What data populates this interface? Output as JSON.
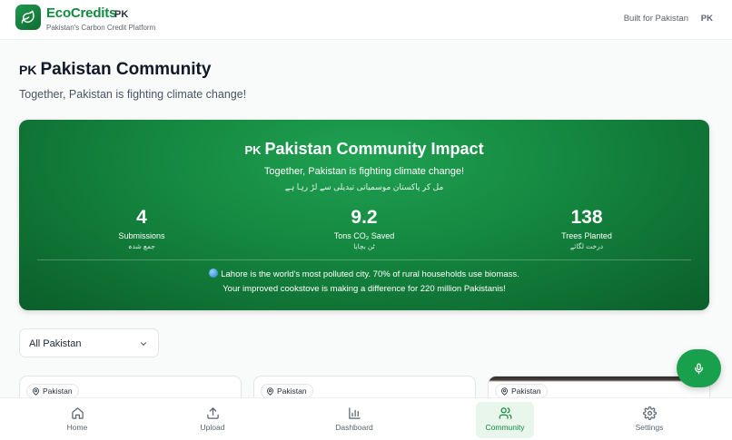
{
  "header": {
    "app_name": "EcoCredits",
    "flag": "PK",
    "tagline": "Pakistan's Carbon Credit Platform",
    "built_for": "Built for Pakistan",
    "built_flag": "PK"
  },
  "page": {
    "flag": "PK",
    "title": "Pakistan Community",
    "subtitle": "Together, Pakistan is fighting climate change!"
  },
  "impact": {
    "flag": "PK",
    "title": "Pakistan Community Impact",
    "subtitle": "Together, Pakistan is fighting climate change!",
    "subtitle_urdu": "مل کر پاکستان موسمیاتی تبدیلی سے لڑ رہا ہے",
    "stats": [
      {
        "value": "4",
        "label": "Submissions",
        "label_urdu": "جمع شدہ"
      },
      {
        "value": "9.2",
        "label": "Tons CO₂ Saved",
        "label_urdu": "ٹن بچایا"
      },
      {
        "value": "138",
        "label": "Trees Planted",
        "label_urdu": "درخت لگائے"
      }
    ],
    "fact_line1": "Lahore is the world's most polluted city. 70% of rural households use biomass.",
    "fact_line2": "Your improved cookstove is making a difference for 220 million Pakistanis!"
  },
  "filter": {
    "selected": "All Pakistan"
  },
  "cards": [
    {
      "location": "Pakistan"
    },
    {
      "location": "Pakistan"
    },
    {
      "location": "Pakistan"
    }
  ],
  "nav": [
    {
      "label": "Home",
      "icon": "home-icon"
    },
    {
      "label": "Upload",
      "icon": "upload-icon"
    },
    {
      "label": "Dashboard",
      "icon": "bar-chart-icon"
    },
    {
      "label": "Community",
      "icon": "users-icon",
      "active": true
    },
    {
      "label": "Settings",
      "icon": "gear-icon"
    }
  ],
  "colors": {
    "brand": "#128a3e",
    "impact_card": "#14863f",
    "fab": "#18a04d",
    "active_nav_bg": "#e8f6ec"
  }
}
